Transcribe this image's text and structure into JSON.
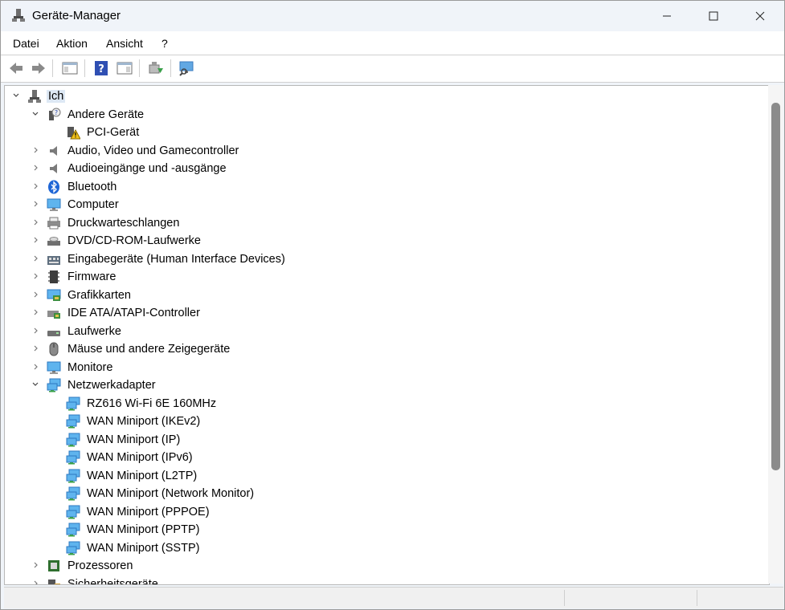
{
  "window": {
    "title": "Geräte-Manager"
  },
  "menu": [
    "Datei",
    "Aktion",
    "Ansicht",
    "?"
  ],
  "toolbar_icons": [
    "back-arrow-icon",
    "forward-arrow-icon",
    "properties-pane-icon",
    "help-icon",
    "view-pane-icon",
    "update-driver-icon",
    "scan-hardware-icon"
  ],
  "tree": {
    "root": "Ich",
    "rows": [
      {
        "label": "Andere Geräte",
        "level": 1,
        "expanded": true,
        "icon": "unknown-device-icon"
      },
      {
        "label": "PCI-Gerät",
        "level": 2,
        "icon": "warning-device-icon"
      },
      {
        "label": "Audio, Video und Gamecontroller",
        "level": 1,
        "expanded": false,
        "icon": "speaker-icon"
      },
      {
        "label": "Audioeingänge und -ausgänge",
        "level": 1,
        "expanded": false,
        "icon": "speaker-icon"
      },
      {
        "label": "Bluetooth",
        "level": 1,
        "expanded": false,
        "icon": "bluetooth-icon"
      },
      {
        "label": "Computer",
        "level": 1,
        "expanded": false,
        "icon": "computer-icon"
      },
      {
        "label": "Druckwarteschlangen",
        "level": 1,
        "expanded": false,
        "icon": "printer-icon"
      },
      {
        "label": "DVD/CD-ROM-Laufwerke",
        "level": 1,
        "expanded": false,
        "icon": "dvd-drive-icon"
      },
      {
        "label": "Eingabegeräte (Human Interface Devices)",
        "level": 1,
        "expanded": false,
        "icon": "hid-icon"
      },
      {
        "label": "Firmware",
        "level": 1,
        "expanded": false,
        "icon": "firmware-icon"
      },
      {
        "label": "Grafikkarten",
        "level": 1,
        "expanded": false,
        "icon": "display-adapter-icon"
      },
      {
        "label": "IDE ATA/ATAPI-Controller",
        "level": 1,
        "expanded": false,
        "icon": "ide-controller-icon"
      },
      {
        "label": "Laufwerke",
        "level": 1,
        "expanded": false,
        "icon": "disk-drive-icon"
      },
      {
        "label": "Mäuse und andere Zeigegeräte",
        "level": 1,
        "expanded": false,
        "icon": "mouse-icon"
      },
      {
        "label": "Monitore",
        "level": 1,
        "expanded": false,
        "icon": "monitor-icon"
      },
      {
        "label": "Netzwerkadapter",
        "level": 1,
        "expanded": true,
        "icon": "network-adapter-icon"
      },
      {
        "label": "RZ616 Wi-Fi 6E 160MHz",
        "level": 2,
        "icon": "network-adapter-icon"
      },
      {
        "label": "WAN Miniport (IKEv2)",
        "level": 2,
        "icon": "network-adapter-icon"
      },
      {
        "label": "WAN Miniport (IP)",
        "level": 2,
        "icon": "network-adapter-icon"
      },
      {
        "label": "WAN Miniport (IPv6)",
        "level": 2,
        "icon": "network-adapter-icon"
      },
      {
        "label": "WAN Miniport (L2TP)",
        "level": 2,
        "icon": "network-adapter-icon"
      },
      {
        "label": "WAN Miniport (Network Monitor)",
        "level": 2,
        "icon": "network-adapter-icon"
      },
      {
        "label": "WAN Miniport (PPPOE)",
        "level": 2,
        "icon": "network-adapter-icon"
      },
      {
        "label": "WAN Miniport (PPTP)",
        "level": 2,
        "icon": "network-adapter-icon"
      },
      {
        "label": "WAN Miniport (SSTP)",
        "level": 2,
        "icon": "network-adapter-icon"
      },
      {
        "label": "Prozessoren",
        "level": 1,
        "expanded": false,
        "icon": "processor-icon"
      },
      {
        "label": "Sicherheitsgeräte",
        "level": 1,
        "expanded": false,
        "icon": "security-device-icon"
      }
    ]
  },
  "colors": {
    "selection": "#dde8f4",
    "scroll_thumb": "#8b8b8b",
    "titlebar": "#f0f4f9"
  }
}
